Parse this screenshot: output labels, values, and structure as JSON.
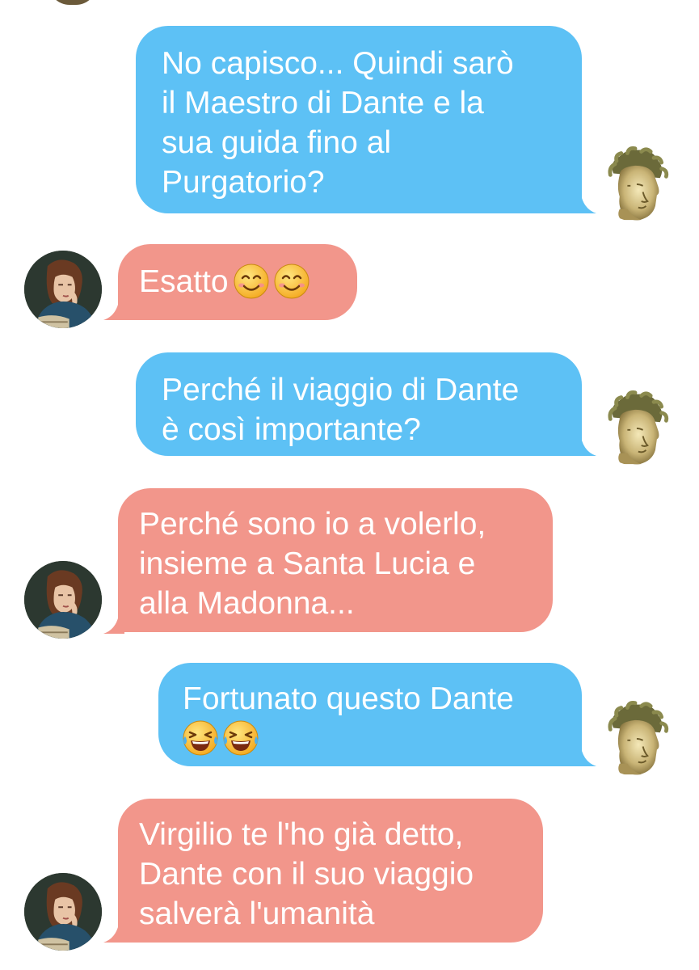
{
  "messages": [
    {
      "id": 1,
      "direction": "outgoing",
      "sender": "Virgilio",
      "lines": [
        "No capisco... Quindi sarò",
        "il Maestro di Dante e la",
        "sua guida fino al",
        "Purgatorio?"
      ]
    },
    {
      "id": 2,
      "direction": "incoming",
      "sender": "Beatrice",
      "lines": [
        "Esatto"
      ],
      "emojis": [
        "smiling-face-icon",
        "smiling-face-icon"
      ]
    },
    {
      "id": 3,
      "direction": "outgoing",
      "sender": "Virgilio",
      "lines": [
        "Perché il viaggio di Dante",
        "è così importante?"
      ]
    },
    {
      "id": 4,
      "direction": "incoming",
      "sender": "Beatrice",
      "lines": [
        "Perché sono io a volerlo,",
        "insieme a Santa Lucia e",
        "alla Madonna..."
      ]
    },
    {
      "id": 5,
      "direction": "outgoing",
      "sender": "Virgilio",
      "lines": [
        "Fortunato questo Dante"
      ],
      "emojis": [
        "tears-of-joy-icon",
        "tears-of-joy-icon"
      ]
    },
    {
      "id": 6,
      "direction": "incoming",
      "sender": "Beatrice",
      "lines": [
        "Virgilio te l'ho già detto,",
        "Dante con il suo viaggio",
        "salverà l'umanità"
      ]
    }
  ],
  "colors": {
    "outgoing_bubble": "#5dc1f5",
    "incoming_bubble": "#f2968b",
    "text": "#ffffff",
    "background": "#ffffff"
  },
  "avatars": {
    "outgoing": "laurel-crowned-poet-avatar",
    "incoming": "pre-raphaelite-woman-avatar"
  }
}
